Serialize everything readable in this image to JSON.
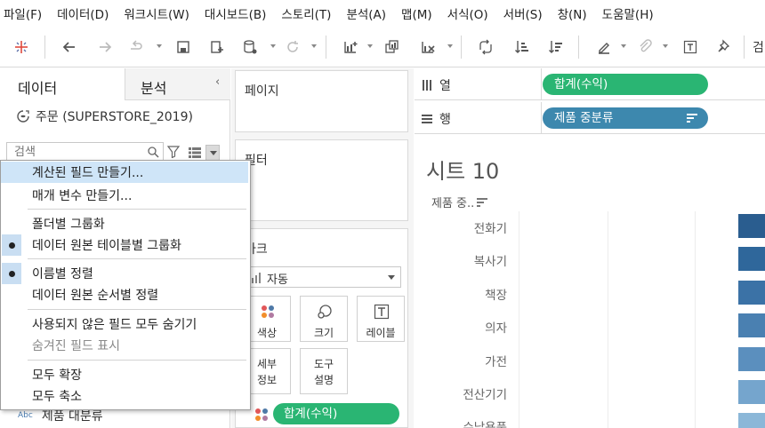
{
  "menubar": [
    {
      "key": "file",
      "label": "파일(F)"
    },
    {
      "key": "data",
      "label": "데이터(D)"
    },
    {
      "key": "worksheet",
      "label": "워크시트(W)"
    },
    {
      "key": "dashboard",
      "label": "대시보드(B)"
    },
    {
      "key": "story",
      "label": "스토리(T)"
    },
    {
      "key": "analysis",
      "label": "분석(A)"
    },
    {
      "key": "map",
      "label": "맵(M)"
    },
    {
      "key": "format",
      "label": "서식(O)"
    },
    {
      "key": "server",
      "label": "서버(S)"
    },
    {
      "key": "window",
      "label": "창(N)"
    },
    {
      "key": "help",
      "label": "도움말(H)"
    }
  ],
  "toolbar_overflow": "검",
  "data_pane": {
    "tab_data": "데이터",
    "tab_analysis": "분석",
    "collapse": "‹",
    "datasource": "주문 (SUPERSTORE_2019)",
    "search_placeholder": "검색",
    "field_last_type": "Abc",
    "field_last_name": "제품 대분류"
  },
  "cards": {
    "pages": "페이지",
    "filters": "필터",
    "marks": "마크",
    "marks_type": "자동",
    "color": "색상",
    "size": "크기",
    "label": "레이블",
    "detail_l1": "세부",
    "detail_l2": "정보",
    "tooltip_l1": "도구",
    "tooltip_l2": "설명",
    "marks_pill": "합계(수익)"
  },
  "shelves": {
    "columns_label": "열",
    "columns_pill": "합계(수익)",
    "rows_label": "행",
    "rows_pill": "제품 중분류"
  },
  "viz": {
    "sheet_title": "시트 10",
    "row_header": "제품 중..",
    "categories": [
      "전화기",
      "복사기",
      "책장",
      "의자",
      "가전",
      "전산기기",
      "수납용품"
    ],
    "bar_colors": [
      "#2a5d8f",
      "#2f679b",
      "#3b72a6",
      "#4a80b1",
      "#5b8fbe",
      "#75a5cd",
      "#8bb7d8"
    ]
  },
  "context_menu": {
    "items": [
      {
        "key": "create-calc-field",
        "label": "계산된 필드 만들기...",
        "state": "highlighted"
      },
      {
        "key": "create-parameter",
        "label": "매개 변수 만들기...",
        "state": "normal"
      },
      {
        "key": "group-by-folder",
        "label": "폴더별 그룹화",
        "state": "normal"
      },
      {
        "key": "group-by-table",
        "label": "데이터 원본 테이블별 그룹화",
        "state": "checked"
      },
      {
        "key": "sort-by-name",
        "label": "이름별 정렬",
        "state": "checked"
      },
      {
        "key": "sort-by-source-order",
        "label": "데이터 원본 순서별 정렬",
        "state": "normal"
      },
      {
        "key": "hide-unused-fields",
        "label": "사용되지 않은 필드 모두 숨기기",
        "state": "normal"
      },
      {
        "key": "show-hidden-fields",
        "label": "숨겨진 필드 표시",
        "state": "disabled"
      },
      {
        "key": "expand-all",
        "label": "모두 확장",
        "state": "normal"
      },
      {
        "key": "collapse-all",
        "label": "모두 축소",
        "state": "normal"
      }
    ]
  }
}
